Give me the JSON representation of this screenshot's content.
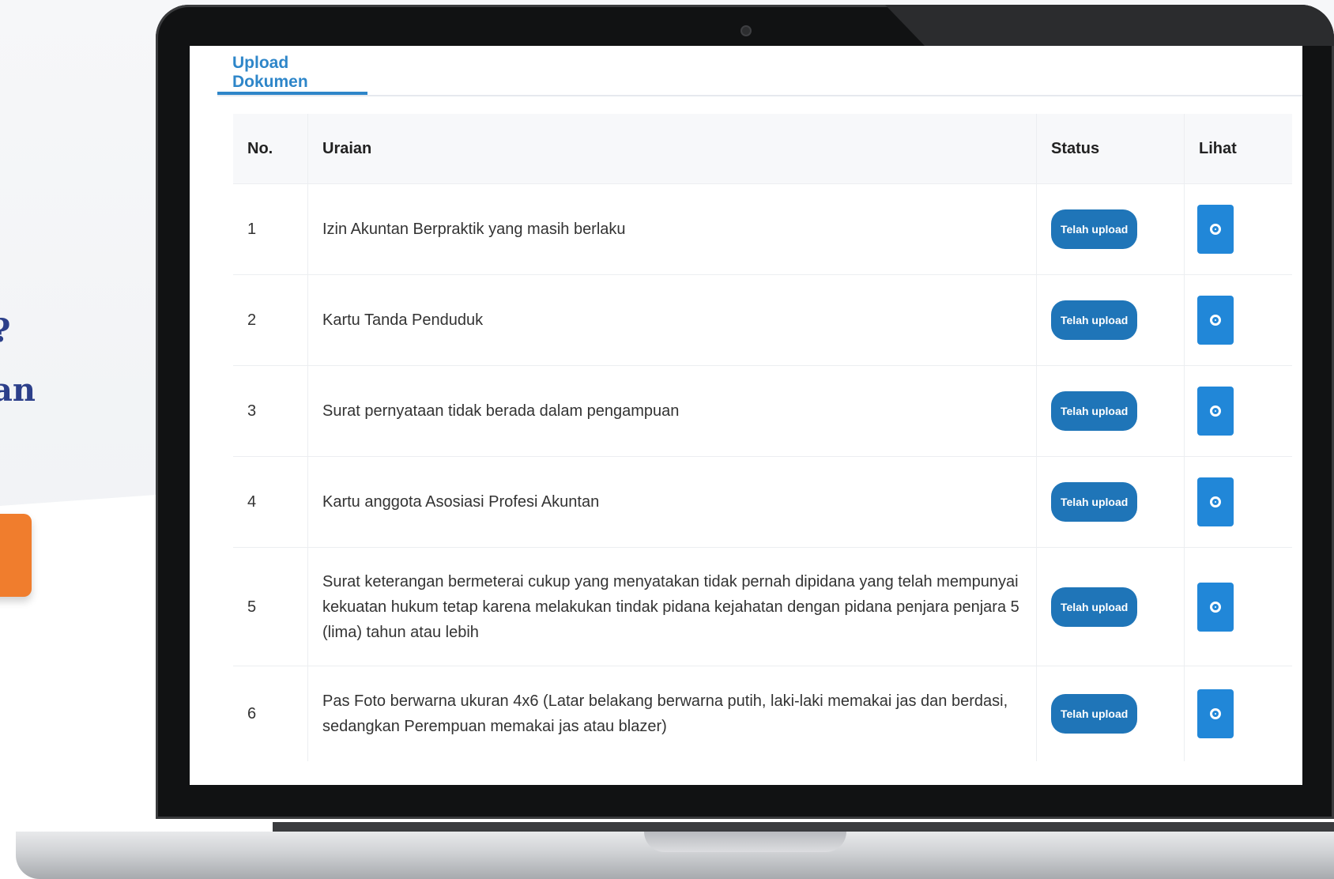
{
  "side": {
    "line1": "?",
    "line2": "an"
  },
  "tab": {
    "label": "Upload Dokumen"
  },
  "table": {
    "headers": {
      "no": "No.",
      "uraian": "Uraian",
      "status": "Status",
      "lihat": "Lihat"
    },
    "rows": [
      {
        "no": "1",
        "uraian": "Izin Akuntan Berpraktik yang masih berlaku",
        "status": "Telah upload"
      },
      {
        "no": "2",
        "uraian": "Kartu Tanda Penduduk",
        "status": "Telah upload"
      },
      {
        "no": "3",
        "uraian": "Surat pernyataan tidak berada dalam pengampuan",
        "status": "Telah upload"
      },
      {
        "no": "4",
        "uraian": "Kartu anggota Asosiasi Profesi Akuntan",
        "status": "Telah upload"
      },
      {
        "no": "5",
        "uraian": "Surat keterangan bermeterai cukup yang menyatakan tidak pernah dipidana yang telah mempunyai kekuatan hukum tetap karena melakukan tindak pidana kejahatan dengan pidana penjara penjara 5 (lima) tahun atau lebih",
        "status": "Telah upload"
      },
      {
        "no": "6",
        "uraian": "Pas Foto berwarna ukuran 4x6 (Latar belakang berwarna putih, laki-laki memakai jas dan berdasi, sedangkan Perempuan memakai jas atau blazer)",
        "status": "Telah upload"
      }
    ]
  },
  "icons": {
    "view": "eye-icon"
  },
  "colors": {
    "accent": "#2e86c9",
    "badge": "#1f75b8",
    "view_button": "#2187d8",
    "orange": "#f07d2d"
  }
}
